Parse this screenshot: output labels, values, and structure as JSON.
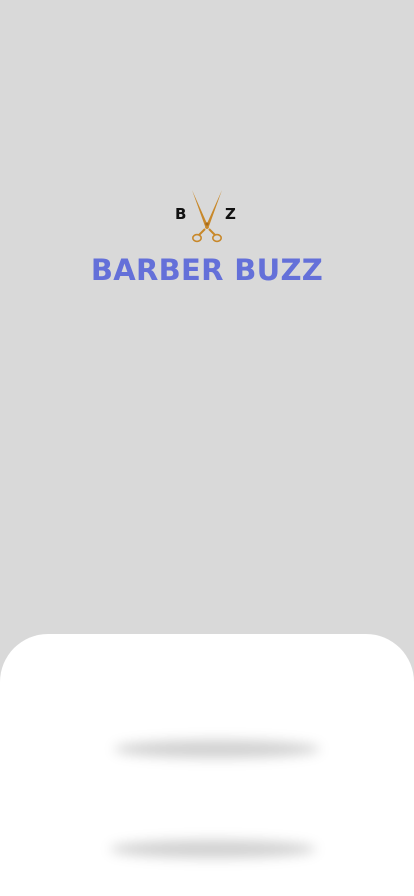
{
  "app": {
    "name": "BARBER BUZZ"
  },
  "logo": {
    "monogram_left": "B",
    "monogram_right": "Z",
    "icon": "scissors-icon",
    "scissors_color": "#c8882a"
  },
  "colors": {
    "background": "#d9d9d9",
    "brand": "#6470d9",
    "sheet": "#ffffff"
  },
  "bottom_sheet": {
    "buttons": [
      {
        "label": ""
      },
      {
        "label": ""
      }
    ]
  }
}
